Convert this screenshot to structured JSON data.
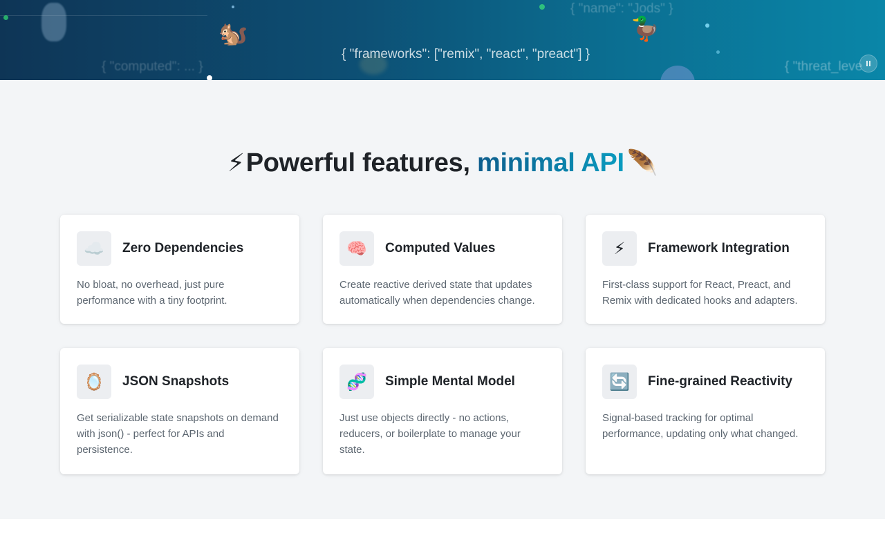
{
  "hero": {
    "json_main": "{ \"frameworks\": [\"remix\", \"react\", \"preact\"] }",
    "json_faded_top": "{ \"name\": \"Jods\" }",
    "json_faded_left": "{ \"computed\": ... }",
    "json_faded_right": "{ \"threat_leve",
    "squirrel_emoji": "🐿️",
    "duck_emoji": "🦆",
    "pause_label": "⏸"
  },
  "features": {
    "heading_bolt": "⚡",
    "heading_plain": "Powerful features, ",
    "heading_accent": "minimal API",
    "heading_feather": "🪶",
    "cards": [
      {
        "icon": "☁️",
        "title": "Zero Dependencies",
        "description": "No bloat, no overhead, just pure performance with a tiny footprint."
      },
      {
        "icon": "🧠",
        "title": "Computed Values",
        "description": "Create reactive derived state that updates automatically when dependencies change."
      },
      {
        "icon": "⚡",
        "title": "Framework Integration",
        "description": "First-class support for React, Preact, and Remix with dedicated hooks and adapters."
      },
      {
        "icon": "🪞",
        "title": "JSON Snapshots",
        "description": "Get serializable state snapshots on demand with json() - perfect for APIs and persistence."
      },
      {
        "icon": "🧬",
        "title": "Simple Mental Model",
        "description": "Just use objects directly - no actions, reducers, or boilerplate to manage your state."
      },
      {
        "icon": "🔄",
        "title": "Fine-grained Reactivity",
        "description": "Signal-based tracking for optimal performance, updating only what changed."
      }
    ]
  }
}
